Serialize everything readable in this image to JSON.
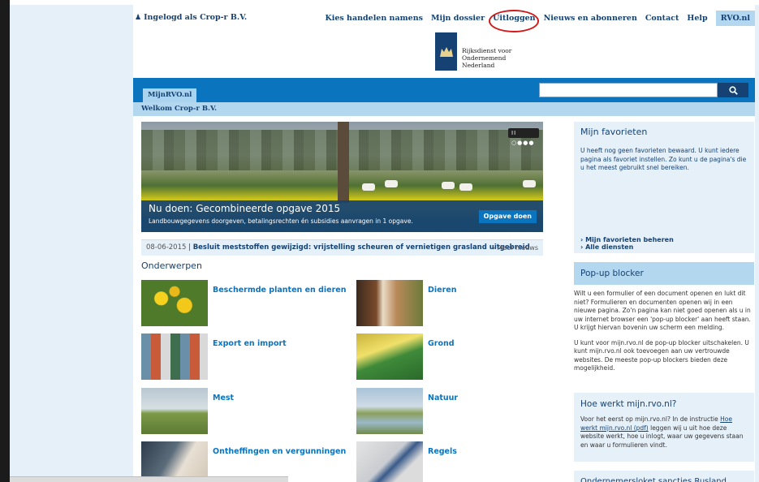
{
  "topbar": {
    "logged_in": "Ingelogd als Crop-r B.V.",
    "nav": [
      "Kies handelen namens",
      "Mijn dossier",
      "Uitloggen",
      "Nieuws en abonneren",
      "Contact",
      "Help",
      "RVO.nl"
    ]
  },
  "logo": {
    "line1": "Rijksdienst voor Ondernemend",
    "line2": "Nederland"
  },
  "navband": {
    "tab": "MijnRVO.nl",
    "welcome": "Welkom Crop-r B.V."
  },
  "hero": {
    "title": "Nu doen: Gecombineerde opgave 2015",
    "subtitle": "Landbouwgegevens doorgeven, betalingsrechten én subsidies aanvragen in 1 opgave.",
    "button": "Opgave doen",
    "slider": "II ○●●●"
  },
  "news": {
    "date": "08-06-2015",
    "headline": "Besluit meststoffen gewijzigd: vrijstelling scheuren of vernietigen grasland uitgebreid",
    "more": "› Meer nieuws"
  },
  "onderwerpen": {
    "title": "Onderwerpen",
    "items": [
      {
        "label": "Beschermde planten en dieren"
      },
      {
        "label": "Dieren"
      },
      {
        "label": "Export en import"
      },
      {
        "label": "Grond"
      },
      {
        "label": "Mest"
      },
      {
        "label": "Natuur"
      },
      {
        "label": "Ontheffingen en vergunningen"
      },
      {
        "label": "Regels"
      }
    ]
  },
  "favorieten": {
    "title": "Mijn favorieten",
    "text": "U heeft nog geen favorieten bewaard. U kunt iedere pagina als favoriet instellen. Zo kunt u de pagina's die u het meest gebruikt snel bereiken.",
    "link1": "› Mijn favorieten beheren",
    "link2": "› Alle diensten"
  },
  "popup": {
    "title": "Pop-up blocker",
    "p1": "Wilt u een formulier of een document openen en lukt dit niet? Formulieren en documenten openen wij in een nieuwe pagina. Zo'n pagina kan niet goed openen als u in uw internet browser een 'pop-up blocker' aan heeft staan. U krijgt hiervan bovenin uw scherm een melding.",
    "p2": "U kunt voor mijn.rvo.nl de pop-up blocker uitschakelen. U kunt mijn.rvo.nl ook toevoegen aan uw vertrouwde websites. De meeste pop-up blockers bieden deze mogelijkheid."
  },
  "hoewerkt": {
    "title": "Hoe werkt mijn.rvo.nl?",
    "text_before": "Voor het eerst op mijn.rvo.nl? In de instructie",
    "link": "Hoe werkt mijn.rvo.nl (pdf)",
    "text_after": "leggen wij u uit hoe deze website werkt, hoe u inlogt, waar uw gegevens staan en waar u formulieren vindt."
  },
  "sanctie": {
    "title": "Ondernemersloket sancties Rusland"
  },
  "colors": {
    "brand_dark": "#154273",
    "brand_blue": "#0a75be",
    "light_blue": "#b2d7ee",
    "pale_blue": "#e6f0f9",
    "annotation_red": "#d11a1a"
  }
}
